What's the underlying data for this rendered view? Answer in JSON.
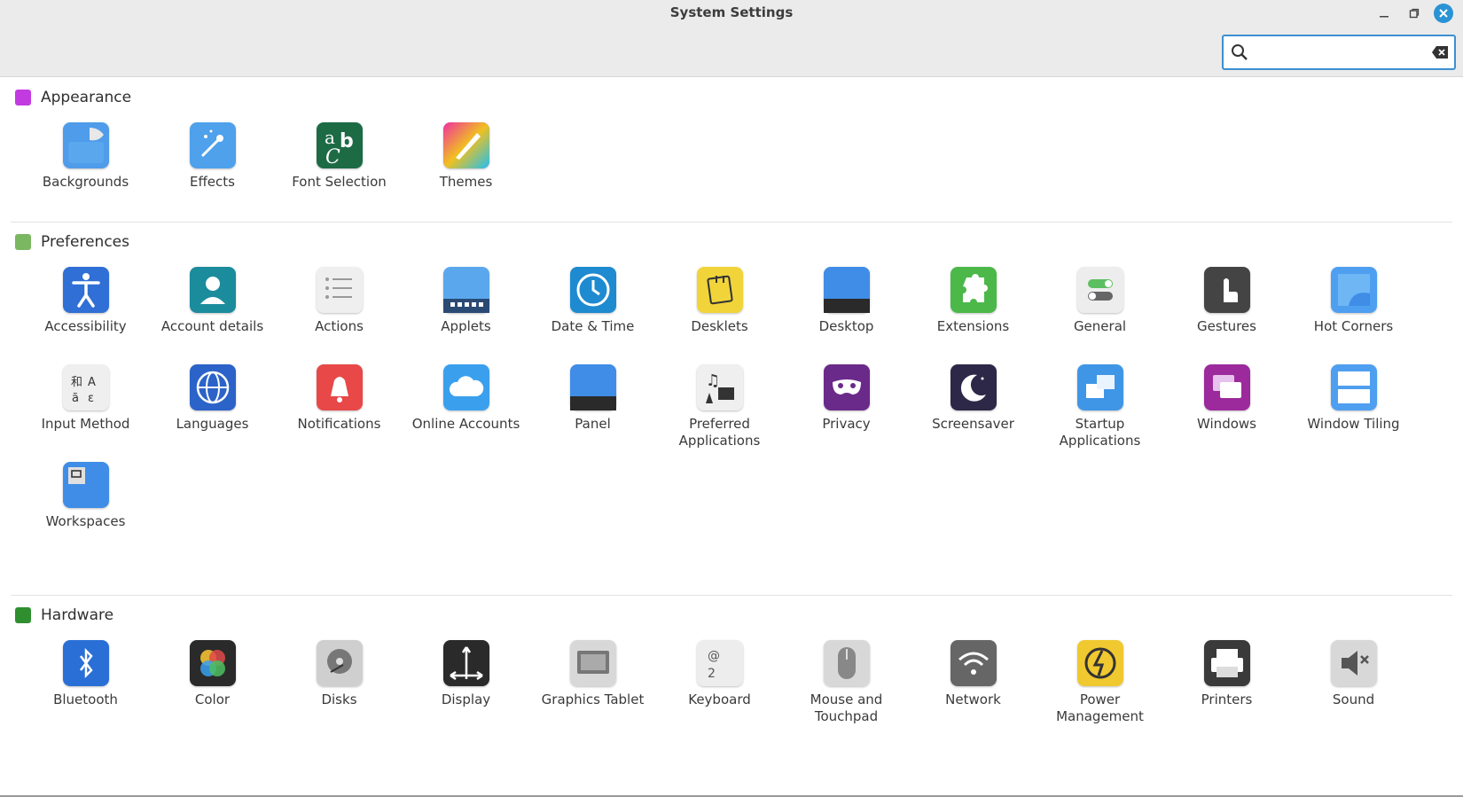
{
  "window": {
    "title": "System Settings"
  },
  "search": {
    "value": "",
    "placeholder": ""
  },
  "sections": [
    {
      "title": "Appearance",
      "color": "#c23be0",
      "items": [
        "Backgrounds",
        "Effects",
        "Font Selection",
        "Themes"
      ]
    },
    {
      "title": "Preferences",
      "color": "#7bb661",
      "items": [
        "Accessibility",
        "Account details",
        "Actions",
        "Applets",
        "Date & Time",
        "Desklets",
        "Desktop",
        "Extensions",
        "General",
        "Gestures",
        "Hot Corners",
        "Input Method",
        "Languages",
        "Notifications",
        "Online Accounts",
        "Panel",
        "Preferred Applications",
        "Privacy",
        "Screensaver",
        "Startup Applications",
        "Windows",
        "Window Tiling",
        "Workspaces"
      ]
    },
    {
      "title": "Hardware",
      "color": "#2f8f2f",
      "items": [
        "Bluetooth",
        "Color",
        "Disks",
        "Display",
        "Graphics Tablet",
        "Keyboard",
        "Mouse and Touchpad",
        "Network",
        "Power Management",
        "Printers",
        "Sound"
      ]
    }
  ]
}
